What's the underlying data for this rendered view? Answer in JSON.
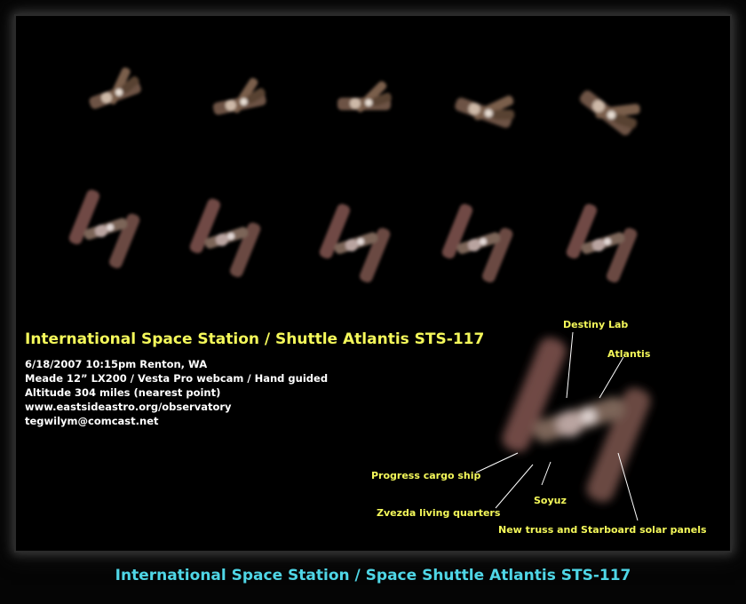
{
  "photo": {
    "title": "International Space Station / Shuttle Atlantis STS-117",
    "details": [
      "6/18/2007 10:15pm Renton, WA",
      "Meade 12” LX200 / Vesta Pro webcam / Hand guided",
      "Altitude 304 miles (nearest point)",
      "www.eastsideastro.org/observatory",
      "tegwilym@comcast.net"
    ]
  },
  "labels": {
    "destiny": "Destiny Lab",
    "atlantis": "Atlantis",
    "progress": "Progress cargo ship",
    "soyuz": "Soyuz",
    "zvezda": "Zvezda living quarters",
    "truss": "New truss and Starboard solar panels"
  },
  "caption": "International Space Station / Space Shuttle Atlantis STS-117",
  "colors": {
    "label_yellow": "#f4f85a",
    "caption_cyan": "#4fd6e6",
    "background": "#000000"
  }
}
